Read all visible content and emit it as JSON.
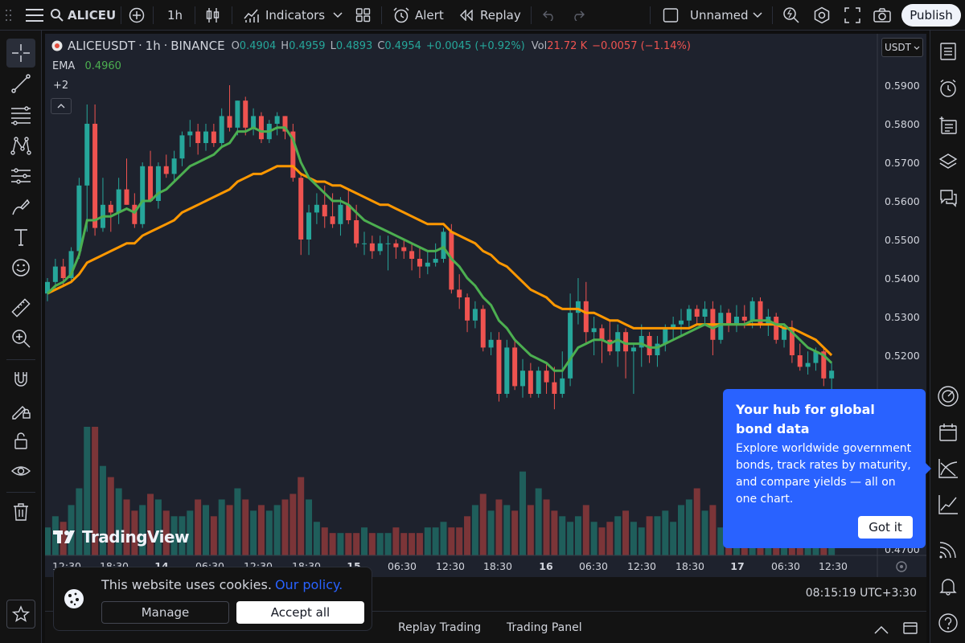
{
  "topbar": {
    "symbol": "ALICEU",
    "interval": "1h",
    "indicators_label": "Indicators",
    "alert_label": "Alert",
    "replay_label": "Replay",
    "layout_name": "Unnamed",
    "publish_label": "Publish"
  },
  "legend": {
    "symbol": "ALICEUSDT",
    "interval": "1h",
    "exchange": "BINANCE",
    "open_key": "O",
    "open": "0.4904",
    "high_key": "H",
    "high": "0.4959",
    "low_key": "L",
    "low": "0.4893",
    "close_key": "C",
    "close": "0.4954",
    "change": "+0.0045 (+0.92%)",
    "vol_key": "Vol",
    "vol": "21.72 K",
    "vol_change": "−0.0057 (−1.14%)",
    "ema_label": "EMA",
    "ema_value": "0.4960",
    "more_indicators": "+2"
  },
  "currency": "USDT",
  "watermark": "TradingView",
  "clock": "08:15:19 UTC+3:30",
  "bottom_tabs": [
    "Replay Trading",
    "Trading Panel"
  ],
  "popup": {
    "title": "Your hub for global bond data",
    "body": "Explore worldwide government bonds, track rates by maturity, and compare yields — all on one chart.",
    "button": "Got it"
  },
  "cookie": {
    "text": "This website uses cookies.",
    "link": "Our policy.",
    "manage": "Manage",
    "accept": "Accept all"
  },
  "colors": {
    "up": "#26a69a",
    "down": "#ef5350",
    "ema_fast": "#4caf50",
    "ema_slow": "#ff9800",
    "accent": "#2962ff"
  },
  "chart_data": {
    "type": "candlestick",
    "price_axis": {
      "ticks": [
        "0.5900",
        "0.5800",
        "0.5700",
        "0.5600",
        "0.5500",
        "0.5400",
        "0.5300",
        "0.5200",
        "0.4700"
      ],
      "ylim": [
        0.47,
        0.5985
      ]
    },
    "time_axis": {
      "ticks": [
        "12:30",
        "18:30",
        "14",
        "06:30",
        "12:30",
        "18:30",
        "15",
        "06:30",
        "12:30",
        "18:30",
        "16",
        "06:30",
        "12:30",
        "18:30",
        "17",
        "06:30",
        "12:30"
      ],
      "bold": [
        "14",
        "15",
        "16",
        "17"
      ]
    },
    "candles": [
      [
        0.536,
        0.54,
        0.534,
        0.539
      ],
      [
        0.539,
        0.545,
        0.537,
        0.543
      ],
      [
        0.543,
        0.545,
        0.538,
        0.54
      ],
      [
        0.54,
        0.548,
        0.539,
        0.547
      ],
      [
        0.547,
        0.566,
        0.545,
        0.564
      ],
      [
        0.564,
        0.585,
        0.552,
        0.58
      ],
      [
        0.58,
        0.585,
        0.551,
        0.553
      ],
      [
        0.553,
        0.566,
        0.552,
        0.559
      ],
      [
        0.559,
        0.56,
        0.552,
        0.557
      ],
      [
        0.557,
        0.566,
        0.554,
        0.563
      ],
      [
        0.563,
        0.571,
        0.559,
        0.559
      ],
      [
        0.559,
        0.562,
        0.553,
        0.554
      ],
      [
        0.554,
        0.57,
        0.553,
        0.569
      ],
      [
        0.569,
        0.573,
        0.56,
        0.56
      ],
      [
        0.56,
        0.57,
        0.558,
        0.569
      ],
      [
        0.569,
        0.572,
        0.566,
        0.567
      ],
      [
        0.567,
        0.573,
        0.565,
        0.571
      ],
      [
        0.571,
        0.578,
        0.569,
        0.577
      ],
      [
        0.577,
        0.581,
        0.574,
        0.578
      ],
      [
        0.578,
        0.58,
        0.572,
        0.575
      ],
      [
        0.575,
        0.58,
        0.573,
        0.578
      ],
      [
        0.578,
        0.58,
        0.574,
        0.575
      ],
      [
        0.575,
        0.584,
        0.574,
        0.582
      ],
      [
        0.582,
        0.59,
        0.578,
        0.579
      ],
      [
        0.579,
        0.586,
        0.577,
        0.586
      ],
      [
        0.586,
        0.587,
        0.577,
        0.579
      ],
      [
        0.579,
        0.584,
        0.577,
        0.582
      ],
      [
        0.582,
        0.583,
        0.575,
        0.576
      ],
      [
        0.576,
        0.581,
        0.575,
        0.58
      ],
      [
        0.58,
        0.583,
        0.577,
        0.582
      ],
      [
        0.582,
        0.582,
        0.576,
        0.578
      ],
      [
        0.578,
        0.58,
        0.565,
        0.566
      ],
      [
        0.566,
        0.567,
        0.546,
        0.55
      ],
      [
        0.55,
        0.559,
        0.546,
        0.557
      ],
      [
        0.557,
        0.562,
        0.554,
        0.559
      ],
      [
        0.559,
        0.564,
        0.553,
        0.556
      ],
      [
        0.556,
        0.562,
        0.553,
        0.554
      ],
      [
        0.554,
        0.561,
        0.551,
        0.559
      ],
      [
        0.559,
        0.563,
        0.554,
        0.555
      ],
      [
        0.555,
        0.559,
        0.548,
        0.549
      ],
      [
        0.549,
        0.552,
        0.546,
        0.549
      ],
      [
        0.549,
        0.551,
        0.545,
        0.547
      ],
      [
        0.547,
        0.551,
        0.546,
        0.549
      ],
      [
        0.549,
        0.551,
        0.542,
        0.549
      ],
      [
        0.549,
        0.55,
        0.545,
        0.548
      ],
      [
        0.548,
        0.55,
        0.545,
        0.547
      ],
      [
        0.547,
        0.549,
        0.542,
        0.545
      ],
      [
        0.545,
        0.548,
        0.54,
        0.543
      ],
      [
        0.543,
        0.547,
        0.541,
        0.544
      ],
      [
        0.544,
        0.549,
        0.543,
        0.545
      ],
      [
        0.545,
        0.553,
        0.544,
        0.552
      ],
      [
        0.552,
        0.554,
        0.536,
        0.537
      ],
      [
        0.537,
        0.541,
        0.532,
        0.535
      ],
      [
        0.535,
        0.536,
        0.526,
        0.529
      ],
      [
        0.529,
        0.534,
        0.527,
        0.532
      ],
      [
        0.532,
        0.533,
        0.521,
        0.522
      ],
      [
        0.522,
        0.526,
        0.52,
        0.524
      ],
      [
        0.524,
        0.526,
        0.508,
        0.51
      ],
      [
        0.51,
        0.524,
        0.509,
        0.522
      ],
      [
        0.522,
        0.524,
        0.511,
        0.512
      ],
      [
        0.512,
        0.519,
        0.509,
        0.516
      ],
      [
        0.516,
        0.518,
        0.509,
        0.51
      ],
      [
        0.51,
        0.517,
        0.509,
        0.516
      ],
      [
        0.516,
        0.518,
        0.51,
        0.513
      ],
      [
        0.513,
        0.517,
        0.506,
        0.51
      ],
      [
        0.51,
        0.521,
        0.509,
        0.514
      ],
      [
        0.514,
        0.536,
        0.512,
        0.531
      ],
      [
        0.531,
        0.54,
        0.528,
        0.534
      ],
      [
        0.534,
        0.539,
        0.523,
        0.526
      ],
      [
        0.526,
        0.53,
        0.52,
        0.527
      ],
      [
        0.527,
        0.528,
        0.518,
        0.524
      ],
      [
        0.524,
        0.529,
        0.52,
        0.521
      ],
      [
        0.521,
        0.528,
        0.517,
        0.526
      ],
      [
        0.526,
        0.527,
        0.514,
        0.521
      ],
      [
        0.521,
        0.523,
        0.51,
        0.522
      ],
      [
        0.522,
        0.528,
        0.517,
        0.525
      ],
      [
        0.525,
        0.526,
        0.518,
        0.52
      ],
      [
        0.52,
        0.525,
        0.517,
        0.523
      ],
      [
        0.523,
        0.528,
        0.521,
        0.527
      ],
      [
        0.527,
        0.53,
        0.524,
        0.528
      ],
      [
        0.528,
        0.532,
        0.525,
        0.529
      ],
      [
        0.529,
        0.533,
        0.527,
        0.532
      ],
      [
        0.532,
        0.533,
        0.528,
        0.53
      ],
      [
        0.53,
        0.534,
        0.528,
        0.532
      ],
      [
        0.532,
        0.534,
        0.52,
        0.524
      ],
      [
        0.524,
        0.533,
        0.523,
        0.531
      ],
      [
        0.531,
        0.532,
        0.526,
        0.528
      ],
      [
        0.528,
        0.533,
        0.526,
        0.53
      ],
      [
        0.53,
        0.533,
        0.527,
        0.529
      ],
      [
        0.529,
        0.535,
        0.527,
        0.534
      ],
      [
        0.534,
        0.535,
        0.527,
        0.528
      ],
      [
        0.528,
        0.532,
        0.525,
        0.53
      ],
      [
        0.53,
        0.531,
        0.523,
        0.524
      ],
      [
        0.524,
        0.528,
        0.522,
        0.527
      ],
      [
        0.527,
        0.529,
        0.518,
        0.52
      ],
      [
        0.52,
        0.523,
        0.516,
        0.517
      ],
      [
        0.517,
        0.521,
        0.515,
        0.518
      ],
      [
        0.518,
        0.522,
        0.516,
        0.521
      ],
      [
        0.521,
        0.522,
        0.512,
        0.514
      ],
      [
        0.514,
        0.518,
        0.511,
        0.516
      ]
    ],
    "ema_fast": [
      0.536,
      0.538,
      0.539,
      0.541,
      0.546,
      0.555,
      0.555,
      0.556,
      0.556,
      0.557,
      0.558,
      0.557,
      0.56,
      0.56,
      0.562,
      0.563,
      0.565,
      0.567,
      0.569,
      0.57,
      0.571,
      0.572,
      0.574,
      0.575,
      0.578,
      0.578,
      0.579,
      0.578,
      0.578,
      0.579,
      0.579,
      0.576,
      0.57,
      0.566,
      0.564,
      0.562,
      0.56,
      0.56,
      0.559,
      0.557,
      0.555,
      0.554,
      0.553,
      0.552,
      0.551,
      0.55,
      0.549,
      0.548,
      0.547,
      0.547,
      0.548,
      0.545,
      0.543,
      0.54,
      0.538,
      0.535,
      0.533,
      0.529,
      0.527,
      0.524,
      0.522,
      0.52,
      0.519,
      0.518,
      0.516,
      0.516,
      0.519,
      0.522,
      0.523,
      0.524,
      0.524,
      0.523,
      0.524,
      0.523,
      0.523,
      0.523,
      0.522,
      0.522,
      0.523,
      0.524,
      0.525,
      0.526,
      0.527,
      0.528,
      0.527,
      0.528,
      0.528,
      0.528,
      0.528,
      0.529,
      0.529,
      0.529,
      0.528,
      0.528,
      0.526,
      0.524,
      0.522,
      0.521,
      0.52,
      0.518
    ],
    "ema_slow": [
      0.536,
      0.537,
      0.538,
      0.539,
      0.541,
      0.544,
      0.545,
      0.546,
      0.547,
      0.548,
      0.549,
      0.549,
      0.551,
      0.552,
      0.553,
      0.554,
      0.555,
      0.557,
      0.558,
      0.559,
      0.56,
      0.561,
      0.562,
      0.563,
      0.565,
      0.566,
      0.567,
      0.567,
      0.568,
      0.569,
      0.569,
      0.569,
      0.567,
      0.566,
      0.565,
      0.565,
      0.564,
      0.564,
      0.563,
      0.562,
      0.561,
      0.56,
      0.559,
      0.559,
      0.558,
      0.557,
      0.556,
      0.555,
      0.554,
      0.554,
      0.554,
      0.552,
      0.551,
      0.55,
      0.549,
      0.547,
      0.546,
      0.544,
      0.543,
      0.541,
      0.539,
      0.537,
      0.536,
      0.535,
      0.533,
      0.532,
      0.532,
      0.532,
      0.531,
      0.531,
      0.53,
      0.529,
      0.529,
      0.528,
      0.527,
      0.527,
      0.527,
      0.527,
      0.527,
      0.527,
      0.527,
      0.527,
      0.528,
      0.528,
      0.528,
      0.528,
      0.528,
      0.528,
      0.528,
      0.528,
      0.528,
      0.528,
      0.528,
      0.527,
      0.527,
      0.526,
      0.525,
      0.524,
      0.522,
      0.52
    ],
    "volume": [
      5,
      7,
      6,
      9,
      12,
      23,
      23,
      16,
      14,
      12,
      10,
      8,
      9,
      11,
      10,
      8,
      7,
      7,
      8,
      10,
      9,
      7,
      10,
      9,
      12,
      10,
      8,
      9,
      8,
      9,
      10,
      11,
      14,
      10,
      6,
      5,
      4,
      4,
      4,
      4,
      5,
      4,
      4,
      4,
      5,
      4,
      4,
      4,
      5,
      5,
      6,
      5,
      5,
      7,
      9,
      11,
      8,
      10,
      9,
      8,
      15,
      9,
      12,
      10,
      8,
      7,
      6,
      7,
      9,
      6,
      5,
      6,
      7,
      8,
      6,
      5,
      7,
      7,
      8,
      6,
      9,
      10,
      12,
      8,
      9,
      5,
      7,
      8,
      6,
      7,
      9,
      8,
      7,
      5,
      6,
      4,
      3,
      4,
      3,
      3
    ]
  }
}
